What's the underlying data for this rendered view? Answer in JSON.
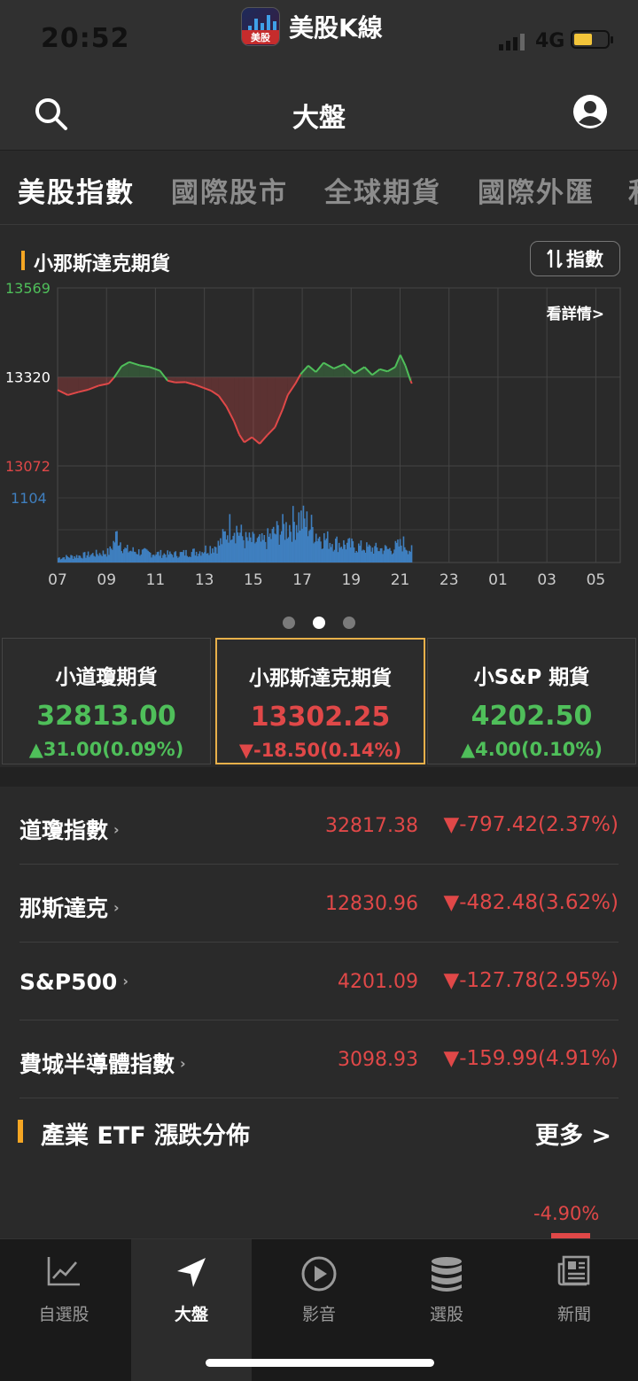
{
  "status_bar": {
    "time": "20:52",
    "network": "4G"
  },
  "app": {
    "name": "美股K線",
    "logo_text": "美股"
  },
  "header": {
    "title": "大盤"
  },
  "tabs": [
    "美股指數",
    "國際股市",
    "全球期貨",
    "國際外匯",
    "和"
  ],
  "chart_section": {
    "title": "小那斯達克期貨",
    "toggle_label": "指數",
    "detail_link": "看詳情>",
    "page_dots": {
      "count": 3,
      "active": 2
    }
  },
  "chart_data": {
    "type": "line",
    "y_labels": {
      "high": "13569",
      "mid": "13320",
      "low": "13072",
      "volume": "1104"
    },
    "x_ticks": [
      "07",
      "09",
      "11",
      "13",
      "15",
      "17",
      "19",
      "21",
      "23",
      "01",
      "03",
      "05"
    ],
    "baseline": 13320,
    "ylim": [
      13072,
      13569
    ],
    "x_range": [
      7,
      29
    ],
    "price": [
      [
        7.0,
        13284
      ],
      [
        7.4,
        13270
      ],
      [
        7.8,
        13278
      ],
      [
        8.2,
        13285
      ],
      [
        8.6,
        13296
      ],
      [
        9.0,
        13302
      ],
      [
        9.2,
        13318
      ],
      [
        9.5,
        13350
      ],
      [
        9.8,
        13362
      ],
      [
        10.2,
        13353
      ],
      [
        10.6,
        13348
      ],
      [
        11.0,
        13338
      ],
      [
        11.3,
        13310
      ],
      [
        11.6,
        13305
      ],
      [
        12.0,
        13306
      ],
      [
        12.4,
        13298
      ],
      [
        12.7,
        13290
      ],
      [
        13.0,
        13282
      ],
      [
        13.3,
        13268
      ],
      [
        13.6,
        13238
      ],
      [
        13.9,
        13196
      ],
      [
        14.1,
        13160
      ],
      [
        14.3,
        13138
      ],
      [
        14.6,
        13152
      ],
      [
        14.9,
        13134
      ],
      [
        15.2,
        13158
      ],
      [
        15.5,
        13180
      ],
      [
        15.8,
        13230
      ],
      [
        16.0,
        13270
      ],
      [
        16.3,
        13302
      ],
      [
        16.5,
        13328
      ],
      [
        16.8,
        13352
      ],
      [
        17.1,
        13334
      ],
      [
        17.4,
        13360
      ],
      [
        17.8,
        13344
      ],
      [
        18.2,
        13356
      ],
      [
        18.6,
        13330
      ],
      [
        19.0,
        13348
      ],
      [
        19.3,
        13326
      ],
      [
        19.6,
        13342
      ],
      [
        19.9,
        13336
      ],
      [
        20.2,
        13348
      ],
      [
        20.4,
        13382
      ],
      [
        20.6,
        13352
      ],
      [
        20.8,
        13310
      ],
      [
        20.85,
        13302
      ]
    ],
    "volume_envelope": [
      [
        7.0,
        120
      ],
      [
        8.0,
        180
      ],
      [
        9.0,
        260
      ],
      [
        9.3,
        700
      ],
      [
        9.6,
        320
      ],
      [
        10.5,
        240
      ],
      [
        11.5,
        200
      ],
      [
        12.5,
        280
      ],
      [
        13.3,
        450
      ],
      [
        13.8,
        1000
      ],
      [
        14.3,
        560
      ],
      [
        15.0,
        500
      ],
      [
        15.5,
        750
      ],
      [
        16.0,
        900
      ],
      [
        16.4,
        1104
      ],
      [
        16.8,
        950
      ],
      [
        17.2,
        650
      ],
      [
        17.8,
        500
      ],
      [
        18.5,
        420
      ],
      [
        19.2,
        350
      ],
      [
        20.0,
        330
      ],
      [
        20.5,
        480
      ],
      [
        20.8,
        300
      ]
    ]
  },
  "futures": [
    {
      "name": "小道瓊期貨",
      "price": "32813.00",
      "change": "▲31.00(0.09%)",
      "dir": "up"
    },
    {
      "name": "小那斯達克期貨",
      "price": "13302.25",
      "change": "▼-18.50(0.14%)",
      "dir": "down"
    },
    {
      "name": "小S&P 期貨",
      "price": "4202.50",
      "change": "▲4.00(0.10%)",
      "dir": "up"
    }
  ],
  "indices": [
    {
      "name": "道瓊指數",
      "value": "32817.38",
      "change": "▼-797.42(2.37%)"
    },
    {
      "name": "那斯達克",
      "value": "12830.96",
      "change": "▼-482.48(3.62%)"
    },
    {
      "name": "S&P500",
      "value": "4201.09",
      "change": "▼-127.78(2.95%)"
    },
    {
      "name": "費城半導體指數",
      "value": "3098.93",
      "change": "▼-159.99(4.91%)"
    }
  ],
  "etf_section": {
    "title": "產業 ETF 漲跌分佈",
    "more": "更多 >",
    "value": "-4.90%"
  },
  "bottom_nav": [
    {
      "label": "自選股",
      "icon": "chart-line-icon"
    },
    {
      "label": "大盤",
      "icon": "navigation-arrow-icon"
    },
    {
      "label": "影音",
      "icon": "play-circle-icon"
    },
    {
      "label": "選股",
      "icon": "database-stack-icon"
    },
    {
      "label": "新聞",
      "icon": "newspaper-icon"
    }
  ],
  "colors": {
    "up": "#4fbf5a",
    "down": "#e04848",
    "volume": "#3f7fbf",
    "accent": "#f5a623",
    "selected_border": "#e8b04a"
  }
}
